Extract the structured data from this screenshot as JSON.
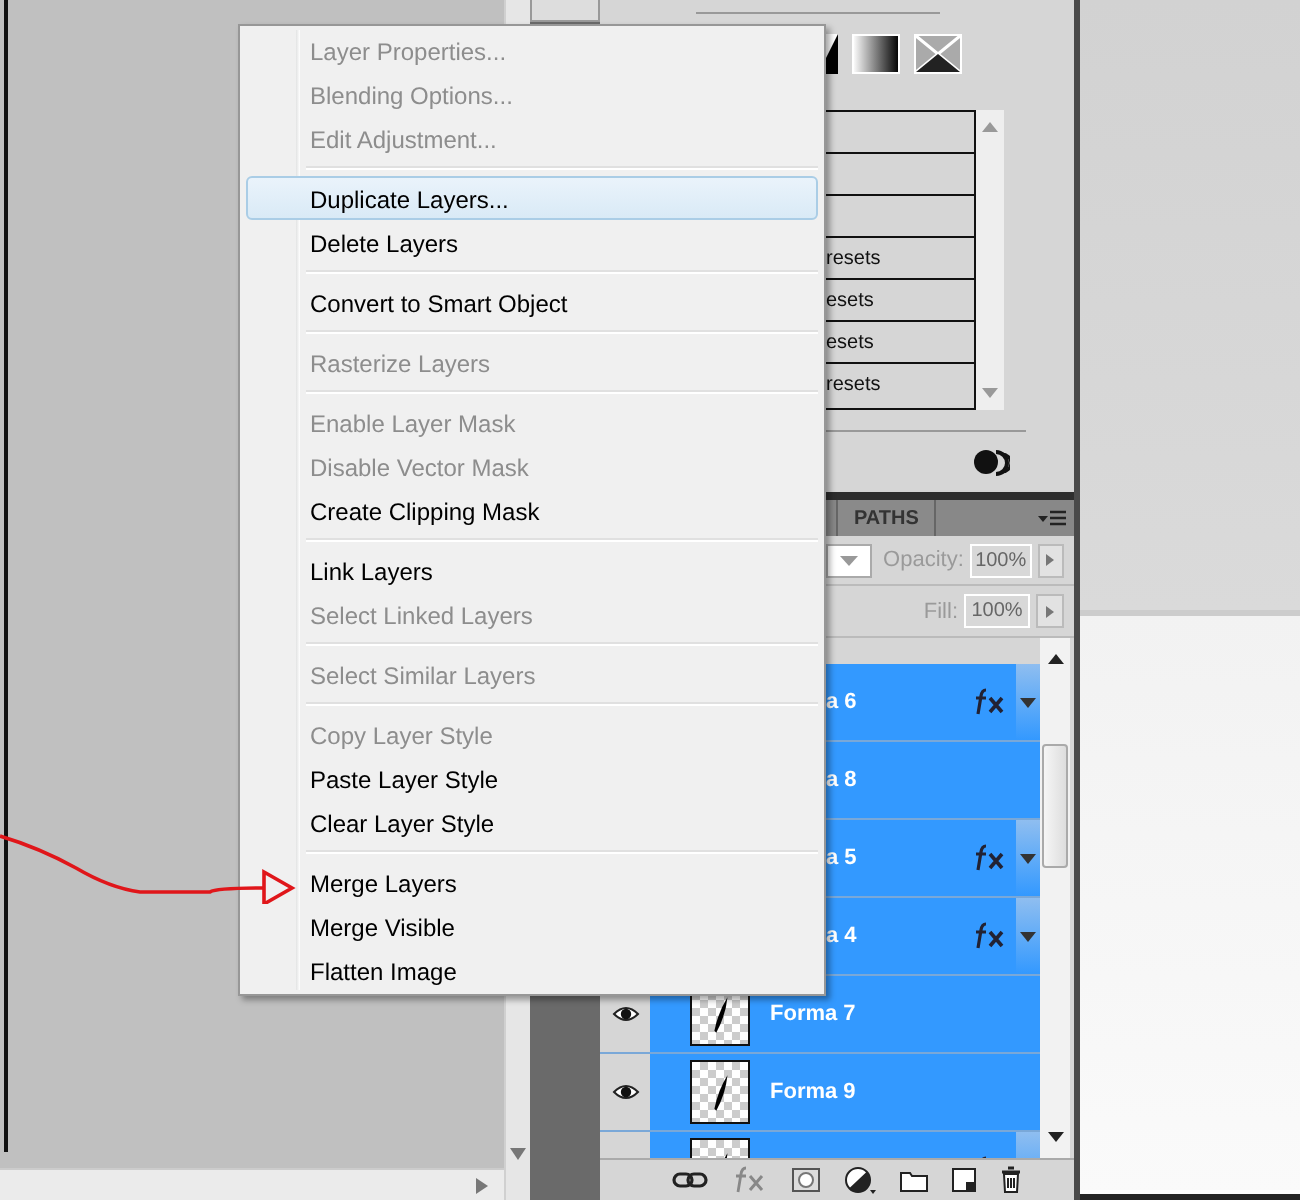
{
  "context_menu": {
    "groups": [
      {
        "items": [
          {
            "label": "Layer Properties...",
            "disabled": true,
            "selected": false
          },
          {
            "label": "Blending Options...",
            "disabled": true,
            "selected": false
          },
          {
            "label": "Edit Adjustment...",
            "disabled": true,
            "selected": false
          }
        ]
      },
      {
        "items": [
          {
            "label": "Duplicate Layers...",
            "disabled": false,
            "selected": true
          },
          {
            "label": "Delete Layers",
            "disabled": false,
            "selected": false
          }
        ]
      },
      {
        "items": [
          {
            "label": "Convert to Smart Object",
            "disabled": false,
            "selected": false
          }
        ]
      },
      {
        "items": [
          {
            "label": "Rasterize Layers",
            "disabled": true,
            "selected": false
          }
        ]
      },
      {
        "items": [
          {
            "label": "Enable Layer Mask",
            "disabled": true,
            "selected": false
          },
          {
            "label": "Disable Vector Mask",
            "disabled": true,
            "selected": false
          },
          {
            "label": "Create Clipping Mask",
            "disabled": false,
            "selected": false
          }
        ]
      },
      {
        "items": [
          {
            "label": "Link Layers",
            "disabled": false,
            "selected": false
          },
          {
            "label": "Select Linked Layers",
            "disabled": true,
            "selected": false
          }
        ]
      },
      {
        "items": [
          {
            "label": "Select Similar Layers",
            "disabled": true,
            "selected": false
          }
        ]
      },
      {
        "items": [
          {
            "label": "Copy Layer Style",
            "disabled": true,
            "selected": false
          },
          {
            "label": "Paste Layer Style",
            "disabled": false,
            "selected": false
          },
          {
            "label": "Clear Layer Style",
            "disabled": false,
            "selected": false
          }
        ]
      },
      {
        "items": [
          {
            "label": "Merge Layers",
            "disabled": false,
            "selected": false
          },
          {
            "label": "Merge Visible",
            "disabled": false,
            "selected": false
          },
          {
            "label": "Flatten Image",
            "disabled": false,
            "selected": false
          }
        ]
      }
    ]
  },
  "presets_list": {
    "rows": [
      {
        "kind": "empty"
      },
      {
        "kind": "empty"
      },
      {
        "kind": "empty"
      },
      {
        "kind": "text",
        "label": "resets"
      },
      {
        "kind": "text",
        "label": "esets"
      },
      {
        "kind": "text",
        "label": "esets"
      },
      {
        "kind": "text",
        "label": "resets"
      }
    ]
  },
  "layers_panel": {
    "tabs": [
      {
        "label": "PATHS",
        "selected": false
      }
    ],
    "options_disabled": true,
    "opacity_label": "Opacity:",
    "opacity": "100%",
    "fill_label": "Fill:",
    "fill": "100%",
    "layers": [
      {
        "name": "a 6",
        "covered": true,
        "effects": true,
        "selected": true
      },
      {
        "name": "a 8",
        "covered": true,
        "effects": false,
        "selected": true
      },
      {
        "name": "a 5",
        "covered": true,
        "effects": true,
        "selected": true
      },
      {
        "name": "a 4",
        "covered": true,
        "effects": true,
        "selected": true
      },
      {
        "name": "Forma 7",
        "covered": false,
        "effects": false,
        "selected": true
      },
      {
        "name": "Forma 9",
        "covered": false,
        "effects": false,
        "selected": true
      },
      {
        "covered": false,
        "effects": true,
        "selected": true
      }
    ]
  }
}
